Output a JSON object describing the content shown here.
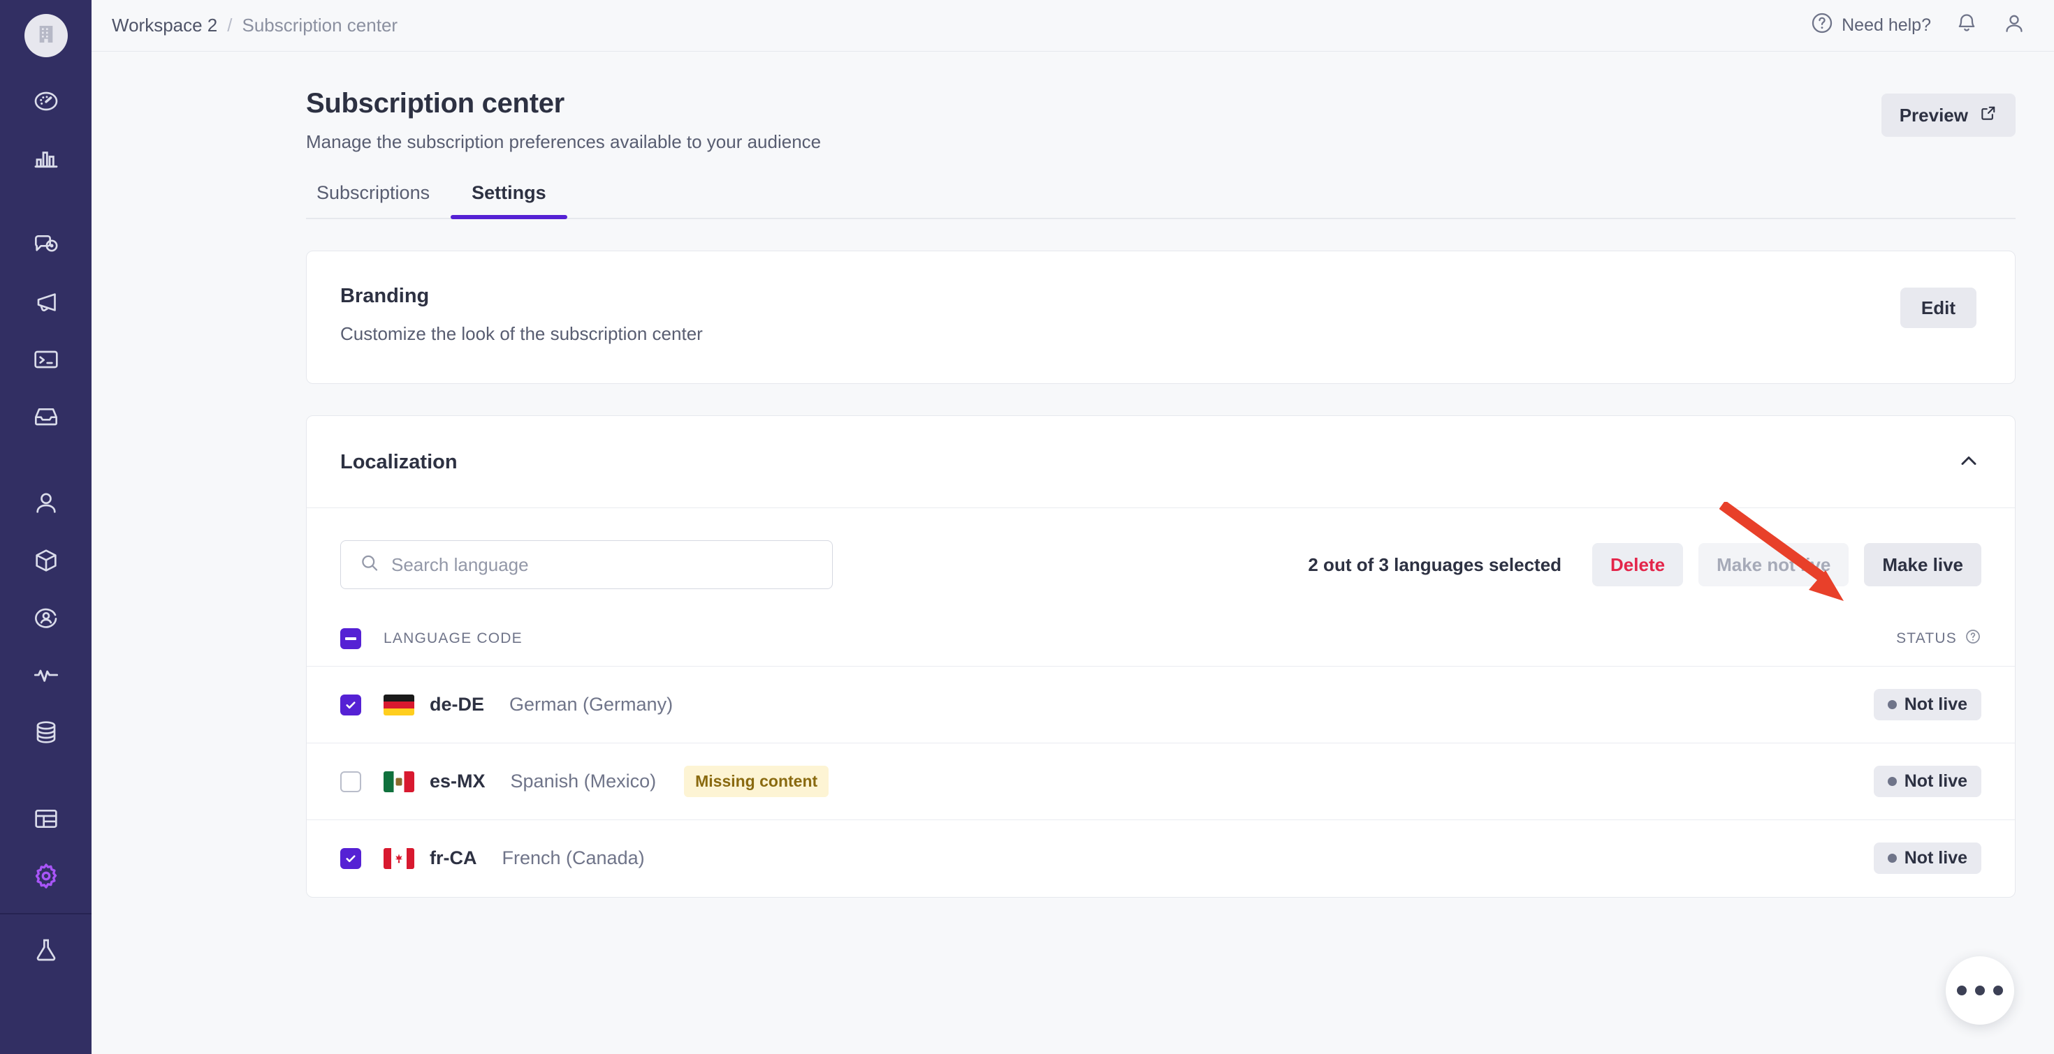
{
  "sidebar": {
    "workspace_avatar_icon": "building-icon",
    "items": [
      {
        "icon": "dashboard-gauge-icon",
        "name": "dashboard",
        "active": false
      },
      {
        "icon": "bar-chart-icon",
        "name": "analytics",
        "active": false
      },
      {
        "icon": "chat-eye-icon",
        "name": "messaging-insights",
        "active": false
      },
      {
        "icon": "megaphone-icon",
        "name": "campaigns",
        "active": false
      },
      {
        "icon": "terminal-icon",
        "name": "developers",
        "active": false
      },
      {
        "icon": "inbox-icon",
        "name": "inbox",
        "active": false
      },
      {
        "icon": "user-icon",
        "name": "audience",
        "active": false
      },
      {
        "icon": "cube-icon",
        "name": "objects",
        "active": false
      },
      {
        "icon": "user-circle-icon",
        "name": "profiles",
        "active": false
      },
      {
        "icon": "activity-pulse-icon",
        "name": "activity",
        "active": false
      },
      {
        "icon": "database-icon",
        "name": "data",
        "active": false
      },
      {
        "icon": "layout-table-icon",
        "name": "layouts",
        "active": false
      },
      {
        "icon": "gear-icon",
        "name": "settings",
        "active": true
      },
      {
        "icon": "flask-icon",
        "name": "labs",
        "active": false
      }
    ],
    "active_color": "#a855f7"
  },
  "topbar": {
    "breadcrumb": {
      "workspace": "Workspace 2",
      "separator": "/",
      "current": "Subscription center"
    },
    "need_help": "Need help?",
    "help_icon": "question-circle-icon",
    "bell_icon": "bell-icon",
    "account_icon": "user-avatar-icon"
  },
  "page": {
    "title": "Subscription center",
    "subtitle": "Manage the subscription preferences available to your audience",
    "preview_button": "Preview",
    "preview_icon": "external-link-icon"
  },
  "tabs": [
    {
      "label": "Subscriptions",
      "active": false
    },
    {
      "label": "Settings",
      "active": true
    }
  ],
  "branding": {
    "title": "Branding",
    "subtitle": "Customize the look of the subscription center",
    "edit_button": "Edit"
  },
  "localization": {
    "title": "Localization",
    "collapse_icon": "chevron-up-icon",
    "search_placeholder": "Search language",
    "search_value": "",
    "search_icon": "search-icon",
    "selection_summary": "2 out of 3 languages selected",
    "actions": [
      {
        "label": "Delete",
        "style": "danger",
        "disabled": false
      },
      {
        "label": "Make not live",
        "style": "default",
        "disabled": true
      },
      {
        "label": "Make live",
        "style": "default",
        "disabled": false
      }
    ],
    "table": {
      "header_checkbox_state": "indeterminate",
      "columns": [
        {
          "key": "checkbox",
          "label": ""
        },
        {
          "key": "language_code",
          "label": "LANGUAGE CODE"
        },
        {
          "key": "status",
          "label": "STATUS",
          "icon": "question-circle-icon"
        }
      ],
      "rows": [
        {
          "checked": true,
          "flag": "flag-de",
          "code": "de-DE",
          "name": "German (Germany)",
          "tag": "",
          "status": "Not live"
        },
        {
          "checked": false,
          "flag": "flag-mx",
          "code": "es-MX",
          "name": "Spanish (Mexico)",
          "tag": "Missing content",
          "status": "Not live"
        },
        {
          "checked": true,
          "flag": "flag-ca",
          "code": "fr-CA",
          "name": "French (Canada)",
          "tag": "",
          "status": "Not live"
        }
      ]
    }
  },
  "annotation": {
    "arrow_color": "#e8402a",
    "points_to": "Make live"
  },
  "fab": {
    "icon": "ellipsis-icon"
  },
  "colors": {
    "sidebar_bg": "#322f63",
    "accent_purple": "#5521d4",
    "active_icon": "#a855f7",
    "page_bg": "#f7f8fa",
    "danger": "#e3254a",
    "warn_bg": "#fdf4d4",
    "warn_text": "#8a6a10"
  }
}
